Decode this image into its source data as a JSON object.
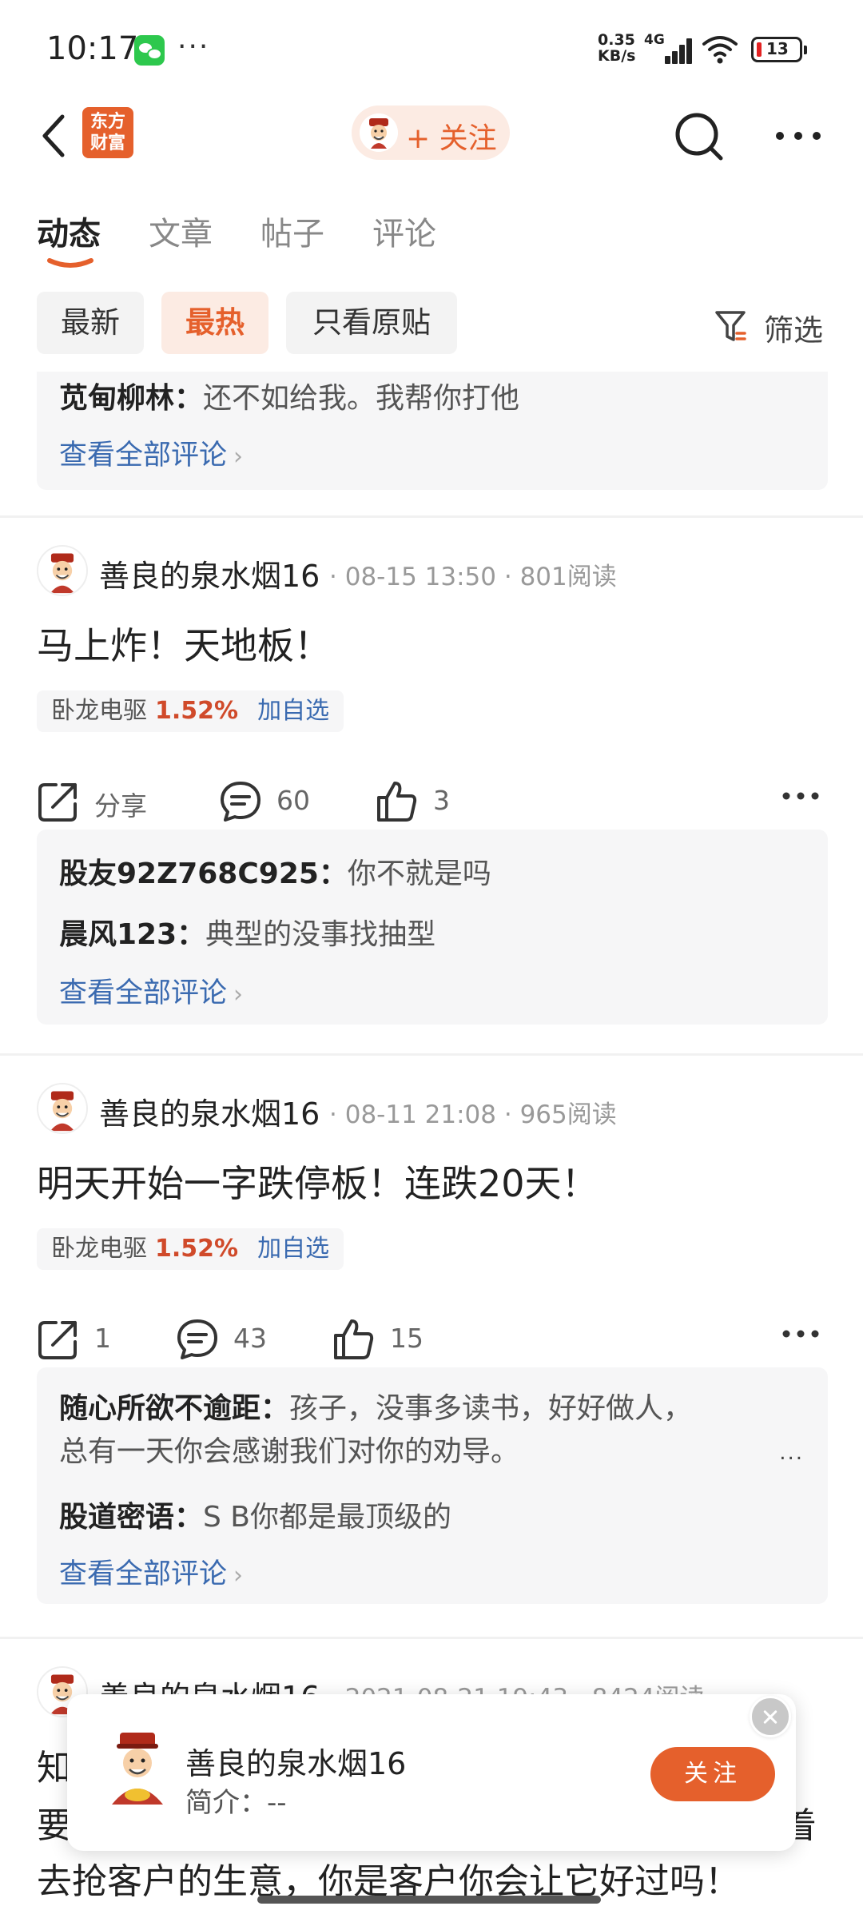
{
  "status_bar": {
    "time": "10:17",
    "dots": "···",
    "net_speed_value": "0.35",
    "net_speed_unit": "KB/s",
    "net_type": "4G",
    "battery": "13"
  },
  "header": {
    "logo_text_line1": "东方",
    "logo_text_line2": "财富",
    "follow_label": "+ 关注"
  },
  "tabs": [
    {
      "label": "动态",
      "active": true
    },
    {
      "label": "文章",
      "active": false
    },
    {
      "label": "帖子",
      "active": false
    },
    {
      "label": "评论",
      "active": false
    }
  ],
  "chips": [
    {
      "label": "最新",
      "active": false
    },
    {
      "label": "最热",
      "active": true
    },
    {
      "label": "只看原贴",
      "active": false
    }
  ],
  "filter_label": "筛选",
  "accent_color": "#e5602c",
  "top_comments": {
    "line1_user": "苋甸柳林：",
    "line1_text": "还不如给我。我帮你打他",
    "view_all": "查看全部评论"
  },
  "posts": [
    {
      "author": "善良的泉水烟16",
      "time": "08-15 13:50",
      "reads": "801阅读",
      "title": "马上炸！天地板！",
      "stock_name": "卧龙电驱",
      "stock_pct": "1.52%",
      "add_watch": "加自选",
      "share": "分享",
      "comments": "60",
      "likes": "3",
      "comment_list": [
        {
          "user": "股友92Z768C925：",
          "text": "你不就是吗"
        },
        {
          "user": "晨风123：",
          "text": "典型的没事找抽型"
        }
      ],
      "view_all": "查看全部评论"
    },
    {
      "author": "善良的泉水烟16",
      "time": "08-11 21:08",
      "reads": "965阅读",
      "title": "明天开始一字跌停板！连跌20天！",
      "stock_name": "卧龙电驱",
      "stock_pct": "1.52%",
      "add_watch": "加自选",
      "share": "1",
      "comments": "43",
      "likes": "15",
      "comment_list": [
        {
          "user": "随心所欲不逾距：",
          "text": "孩子，没事多读书，好好做人，",
          "text2": "总有一天你会感谢我们对你的劝导。"
        },
        {
          "user": "股道密语：",
          "text": "S B你都是最顶级的"
        }
      ],
      "more_mini": "...",
      "view_all": "查看全部评论"
    },
    {
      "author": "善良的泉水烟16",
      "time": "2021-08-21 19:43",
      "reads": "8424阅读",
      "line1_left": "知",
      "line2_left": "要",
      "line2_right": "着",
      "line3": "去抢客户的生意，你是客户你会让它好过吗！"
    }
  ],
  "popup": {
    "name": "善良的泉水烟16",
    "intro": "简介：--",
    "follow": "关注"
  }
}
